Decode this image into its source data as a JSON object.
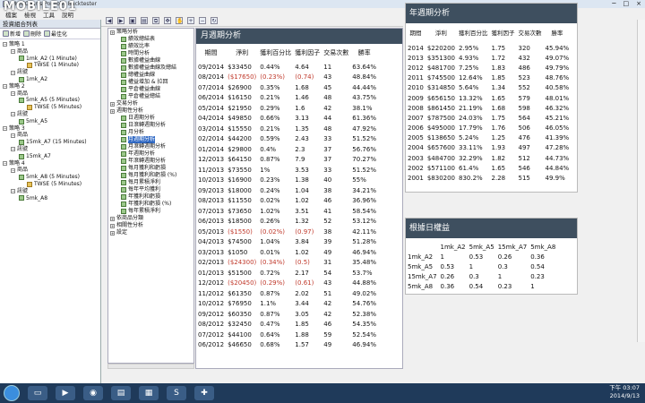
{
  "window": {
    "title": "投資組合績效報告",
    "app": "MultiCharts Portfolio Backtester",
    "logo": "MOBILE01",
    "min": "─",
    "max": "□",
    "close": "×"
  },
  "menu": [
    "檔案",
    "檢視",
    "工具",
    "說明"
  ],
  "left_panel": {
    "header": "投資組合列表",
    "tb_add": "新增",
    "tb_del": "刪除",
    "tb_opt": "最佳化",
    "items": [
      {
        "label": "策略 1",
        "level": 0
      },
      {
        "label": "商品",
        "level": 1
      },
      {
        "label": "1mk_A2 (1 Minute)",
        "level": 2
      },
      {
        "label": "TWSE (1 Minute)",
        "level": 3
      },
      {
        "label": "訊號",
        "level": 1
      },
      {
        "label": "1mk_A2",
        "level": 2
      },
      {
        "label": "策略 2",
        "level": 0
      },
      {
        "label": "商品",
        "level": 1
      },
      {
        "label": "5mk_A5 (5 Minutes)",
        "level": 2
      },
      {
        "label": "TWSE (5 Minutes)",
        "level": 3
      },
      {
        "label": "訊號",
        "level": 1
      },
      {
        "label": "5mk_A5",
        "level": 2
      },
      {
        "label": "策略 3",
        "level": 0
      },
      {
        "label": "商品",
        "level": 1
      },
      {
        "label": "15mk_A7 (15 Minutes)",
        "level": 2
      },
      {
        "label": "訊號",
        "level": 1
      },
      {
        "label": "15mk_A7",
        "level": 2
      },
      {
        "label": "策略 4",
        "level": 0
      },
      {
        "label": "商品",
        "level": 1
      },
      {
        "label": "5mk_A8 (5 Minutes)",
        "level": 2
      },
      {
        "label": "TWSE (5 Minutes)",
        "level": 3
      },
      {
        "label": "訊號",
        "level": 1
      },
      {
        "label": "5mk_A8",
        "level": 2
      }
    ]
  },
  "nav": [
    {
      "label": "策略分析",
      "level": 0
    },
    {
      "label": "績效總結表",
      "level": 1
    },
    {
      "label": "績效比率",
      "level": 1
    },
    {
      "label": "時間分析",
      "level": 1
    },
    {
      "label": "數據權益曲線",
      "level": 1
    },
    {
      "label": "數據權益曲線及總結",
      "level": 1
    },
    {
      "label": "總權益曲線",
      "level": 1
    },
    {
      "label": "權益增加 & 拉回",
      "level": 1
    },
    {
      "label": "平倉權益曲線",
      "level": 1
    },
    {
      "label": "平倉權益總結",
      "level": 1
    },
    {
      "label": "交易分析",
      "level": 0
    },
    {
      "label": "週期性分析",
      "level": 0
    },
    {
      "label": "日週期分析",
      "level": 1
    },
    {
      "label": "日滾轉週期分析",
      "level": 1
    },
    {
      "label": "月分析",
      "level": 1
    },
    {
      "label": "月週期分析",
      "level": 1,
      "selected": true
    },
    {
      "label": "月滾轉週期分析",
      "level": 1
    },
    {
      "label": "年週期分析",
      "level": 1
    },
    {
      "label": "年滾轉週期分析",
      "level": 1
    },
    {
      "label": "每月獲利和虧損",
      "level": 1
    },
    {
      "label": "每月獲利和虧損 (%)",
      "level": 1
    },
    {
      "label": "每月累積淨利",
      "level": 1
    },
    {
      "label": "每年平均獲利",
      "level": 1
    },
    {
      "label": "年獲利和虧損",
      "level": 1
    },
    {
      "label": "年獲利和虧損 (%)",
      "level": 1
    },
    {
      "label": "每年累積淨利",
      "level": 1
    },
    {
      "label": "依商品分類",
      "level": 0
    },
    {
      "label": "相關性分析",
      "level": 0
    },
    {
      "label": "設定",
      "level": 0
    }
  ],
  "monthly": {
    "title": "月週期分析",
    "headers": [
      "期間",
      "淨利",
      "獲利百分比",
      "獲利因子",
      "交易次數",
      "勝率"
    ],
    "rows": [
      [
        "09/2014",
        "$33450",
        "0.44%",
        "4.64",
        "11",
        "63.64%"
      ],
      [
        "08/2014",
        "($17650)",
        "(0.23%)",
        "(0.74)",
        "43",
        "48.84%"
      ],
      [
        "07/2014",
        "$26900",
        "0.35%",
        "1.68",
        "45",
        "44.44%"
      ],
      [
        "06/2014",
        "$16150",
        "0.21%",
        "1.46",
        "48",
        "43.75%"
      ],
      [
        "05/2014",
        "$21950",
        "0.29%",
        "1.6",
        "42",
        "38.1%"
      ],
      [
        "04/2014",
        "$49850",
        "0.66%",
        "3.13",
        "44",
        "61.36%"
      ],
      [
        "03/2014",
        "$15550",
        "0.21%",
        "1.35",
        "48",
        "47.92%"
      ],
      [
        "02/2014",
        "$44200",
        "0.59%",
        "2.43",
        "33",
        "51.52%"
      ],
      [
        "01/2014",
        "$29800",
        "0.4%",
        "2.3",
        "37",
        "56.76%"
      ],
      [
        "12/2013",
        "$64150",
        "0.87%",
        "7.9",
        "37",
        "70.27%"
      ],
      [
        "11/2013",
        "$73550",
        "1%",
        "3.53",
        "33",
        "51.52%"
      ],
      [
        "10/2013",
        "$16900",
        "0.23%",
        "1.38",
        "40",
        "55%"
      ],
      [
        "09/2013",
        "$18000",
        "0.24%",
        "1.04",
        "38",
        "34.21%"
      ],
      [
        "08/2013",
        "$11550",
        "0.02%",
        "1.02",
        "46",
        "36.96%"
      ],
      [
        "07/2013",
        "$73650",
        "1.02%",
        "3.51",
        "41",
        "58.54%"
      ],
      [
        "06/2013",
        "$18500",
        "0.26%",
        "1.32",
        "52",
        "53.12%"
      ],
      [
        "05/2013",
        "($1550)",
        "(0.02%)",
        "(0.97)",
        "38",
        "42.11%"
      ],
      [
        "04/2013",
        "$74500",
        "1.04%",
        "3.84",
        "39",
        "51.28%"
      ],
      [
        "03/2013",
        "$1050",
        "0.01%",
        "1.02",
        "49",
        "46.94%"
      ],
      [
        "02/2013",
        "($24300)",
        "(0.34%)",
        "(0.5)",
        "31",
        "35.48%"
      ],
      [
        "01/2013",
        "$51500",
        "0.72%",
        "2.17",
        "54",
        "53.7%"
      ],
      [
        "12/2012",
        "($20450)",
        "(0.29%)",
        "(0.61)",
        "43",
        "44.88%"
      ],
      [
        "11/2012",
        "$61350",
        "0.87%",
        "2.02",
        "51",
        "49.02%"
      ],
      [
        "10/2012",
        "$76950",
        "1.1%",
        "3.44",
        "42",
        "54.76%"
      ],
      [
        "09/2012",
        "$60350",
        "0.87%",
        "3.05",
        "42",
        "52.38%"
      ],
      [
        "08/2012",
        "$32450",
        "0.47%",
        "1.85",
        "46",
        "54.35%"
      ],
      [
        "07/2012",
        "$44100",
        "0.64%",
        "1.88",
        "59",
        "52.54%"
      ],
      [
        "06/2012",
        "$46650",
        "0.68%",
        "1.57",
        "49",
        "46.94%"
      ]
    ]
  },
  "yearly": {
    "title": "年週期分析",
    "headers": [
      "期間",
      "淨利",
      "獲利百分比",
      "獲利因子",
      "交易次數",
      "勝率"
    ],
    "rows": [
      [
        "2014",
        "$220200",
        "2.95%",
        "1.75",
        "320",
        "45.94%"
      ],
      [
        "2013",
        "$351300",
        "4.93%",
        "1.72",
        "432",
        "49.07%"
      ],
      [
        "2012",
        "$481700",
        "7.25%",
        "1.83",
        "486",
        "49.79%"
      ],
      [
        "2011",
        "$745500",
        "12.64%",
        "1.85",
        "523",
        "48.76%"
      ],
      [
        "2010",
        "$314850",
        "5.64%",
        "1.34",
        "552",
        "40.58%"
      ],
      [
        "2009",
        "$656150",
        "13.32%",
        "1.65",
        "579",
        "48.01%"
      ],
      [
        "2008",
        "$861450",
        "21.19%",
        "1.68",
        "598",
        "46.32%"
      ],
      [
        "2007",
        "$787500",
        "24.03%",
        "1.75",
        "564",
        "45.21%"
      ],
      [
        "2006",
        "$495000",
        "17.79%",
        "1.76",
        "506",
        "46.05%"
      ],
      [
        "2005",
        "$138650",
        "5.24%",
        "1.25",
        "476",
        "41.39%"
      ],
      [
        "2004",
        "$657600",
        "33.11%",
        "1.93",
        "497",
        "47.28%"
      ],
      [
        "2003",
        "$484700",
        "32.29%",
        "1.82",
        "512",
        "44.73%"
      ],
      [
        "2002",
        "$571100",
        "61.4%",
        "1.65",
        "546",
        "44.84%"
      ],
      [
        "2001",
        "$830200",
        "830.2%",
        "2.28",
        "515",
        "49.9%"
      ]
    ]
  },
  "correlation": {
    "title": "根據日權益",
    "cols": [
      "",
      "1mk_A2",
      "5mk_A5",
      "15mk_A7",
      "5mk_A8"
    ],
    "rows": [
      [
        "1mk_A2",
        "1",
        "0.53",
        "0.26",
        "0.36"
      ],
      [
        "5mk_A5",
        "0.53",
        "1",
        "0.3",
        "0.54"
      ],
      [
        "15mk_A7",
        "0.26",
        "0.3",
        "1",
        "0.23"
      ],
      [
        "5mk_A8",
        "0.36",
        "0.54",
        "0.23",
        "1"
      ]
    ]
  },
  "clock": {
    "time": "下午 03:07",
    "date": "2014/9/13"
  }
}
